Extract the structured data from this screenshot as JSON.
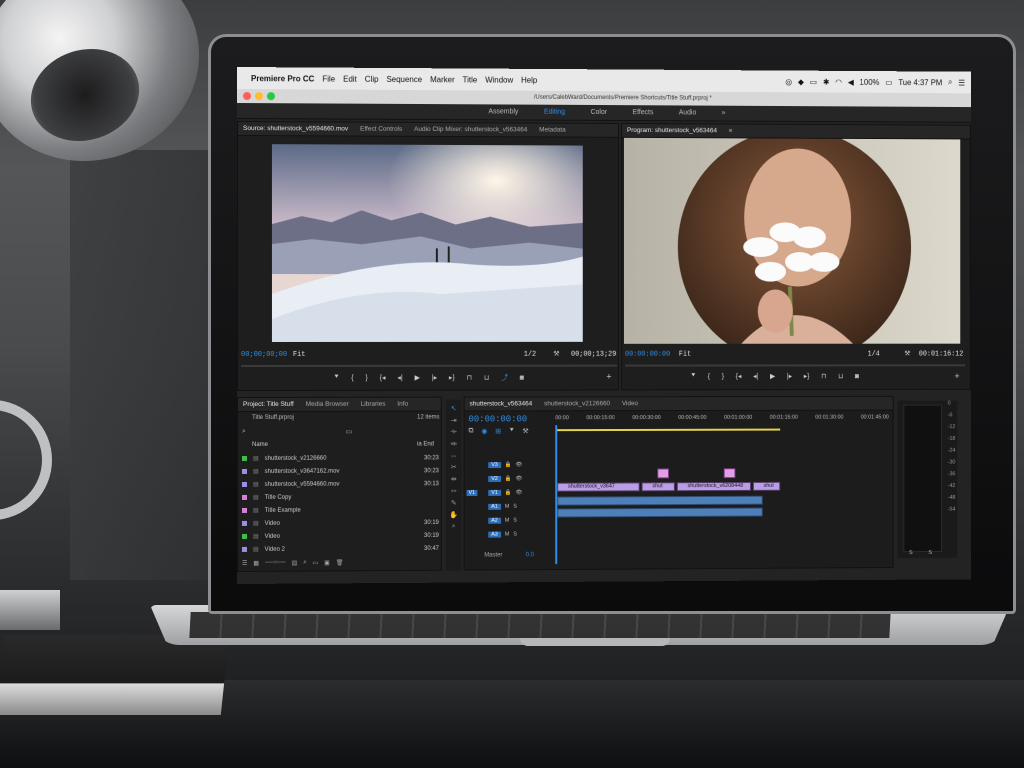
{
  "menubar": {
    "apple": "",
    "app": "Premiere Pro CC",
    "items": [
      "File",
      "Edit",
      "Clip",
      "Sequence",
      "Marker",
      "Title",
      "Window",
      "Help"
    ],
    "battery": "100%",
    "clock": "Tue 4:37 PM"
  },
  "titlebar": {
    "path": "/Users/CalebWard/Documents/Premiere Shortcuts/Title Stuff.prproj *"
  },
  "workspaces": {
    "items": [
      "Assembly",
      "Editing",
      "Color",
      "Effects",
      "Audio"
    ],
    "active": "Editing",
    "more": "»"
  },
  "source": {
    "tabs": [
      "Source: shutterstock_v5594660.mov",
      "Effect Controls",
      "Audio Clip Mixer: shutterstock_v563464",
      "Metadata"
    ],
    "timecode_in": "00;00;00;00",
    "fit": "Fit",
    "ratio": "1/2",
    "timecode_out": "00;00;13;29"
  },
  "program": {
    "tab": "Program: shutterstock_v563464",
    "timecode_in": "00:00:00:00",
    "fit": "Fit",
    "ratio": "1/4",
    "timecode_out": "00:01:16:12"
  },
  "project": {
    "tabs": [
      "Project: Title Stuff",
      "Media Browser",
      "Libraries",
      "Info"
    ],
    "file": "Title Stuff.prproj",
    "count": "12 items",
    "col_name": "Name",
    "col_end": "ia End",
    "items": [
      {
        "name": "shutterstock_v2126660",
        "end": "30:23",
        "color": "#3dbf4a"
      },
      {
        "name": "shutterstock_v3647162.mov",
        "end": "30:23",
        "color": "#9b8fe6"
      },
      {
        "name": "shutterstock_v5594660.mov",
        "end": "30:13",
        "color": "#9b8fe6"
      },
      {
        "name": "Title Copy",
        "end": "",
        "color": "#d77fd4"
      },
      {
        "name": "Title Example",
        "end": "",
        "color": "#d77fd4"
      },
      {
        "name": "Video",
        "end": "30:19",
        "color": "#9b8fe6"
      },
      {
        "name": "Video",
        "end": "30:19",
        "color": "#3dbf4a"
      },
      {
        "name": "Video 2",
        "end": "30:47",
        "color": "#9b8fe6"
      }
    ]
  },
  "timeline": {
    "tabs": [
      "shutterstock_v563464",
      "shutterstock_v2126660",
      "Video"
    ],
    "timecode": "00:00:00:00",
    "ruler": [
      "00:00",
      "00:00:15:00",
      "00:00:30:00",
      "00:00:45:00",
      "00:01:00:00",
      "00:01:15:00",
      "00:01:30:00",
      "00:01:45:00"
    ],
    "tracks": [
      "V3",
      "V2",
      "V1",
      "A1",
      "A2",
      "A3"
    ],
    "src_v": "V1",
    "master": "Master",
    "master_val": "0.0",
    "clips": [
      "shutterstock_v3647",
      "shut",
      "shutterstock_v6208448",
      "shut"
    ],
    "track_m": "M",
    "track_s": "S"
  },
  "meter": {
    "labels": [
      "0",
      "-6",
      "-12",
      "-18",
      "-24",
      "-30",
      "-36",
      "-42",
      "-48",
      "-54"
    ],
    "s1": "S",
    "s2": "S"
  },
  "colors": {
    "accent": "#2f8fe8",
    "pink_clip": "#e39ee8",
    "purple_clip": "#b89ee6",
    "audio_clip": "#4f7fb8"
  }
}
